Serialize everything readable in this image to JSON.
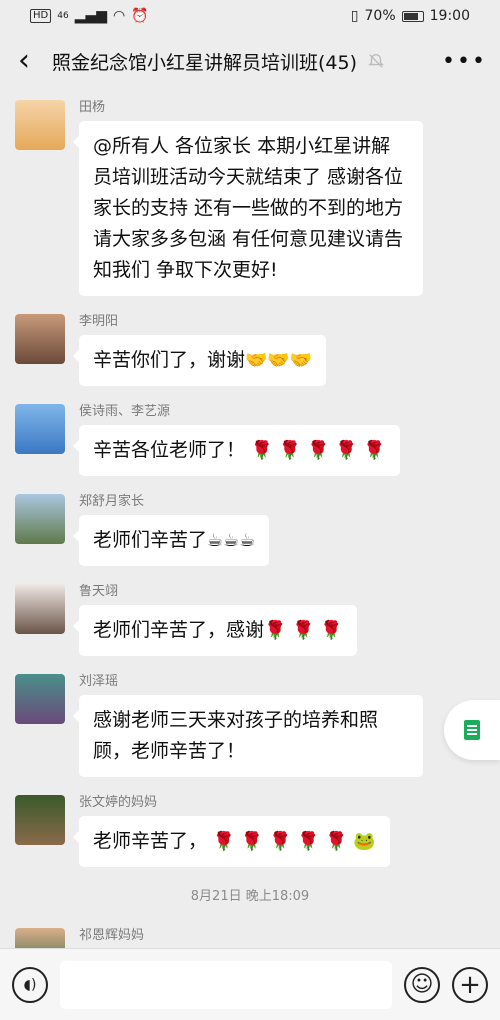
{
  "status_bar": {
    "hd": "HD",
    "signal": "46",
    "battery": "70%",
    "battery_level": 0.7,
    "time": "19:00"
  },
  "header": {
    "back_icon": "back-chevron-icon",
    "title": "照金纪念馆小红星讲解员培训班(45)",
    "mute_icon": "bell-muted-icon",
    "more_icon": "more-dots-icon"
  },
  "messages": [
    {
      "sender": "田杨",
      "text": "@所有人  各位家长 本期小红星讲解员培训班活动今天就结束了 感谢各位家长的支持 还有一些做的不到的地方请大家多多包涵 有任何意见建议请告知我们 争取下次更好!",
      "emoji": ""
    },
    {
      "sender": "李明阳",
      "text": "辛苦你们了，谢谢",
      "emoji": "🤝🤝🤝"
    },
    {
      "sender": "侯诗雨、李艺源",
      "text": "辛苦各位老师了！",
      "emoji": " 🌹 🌹 🌹 🌹 🌹"
    },
    {
      "sender": "郑舒月家长",
      "text": "老师们辛苦了",
      "emoji": "☕☕☕"
    },
    {
      "sender": "鲁天翊",
      "text": "老师们辛苦了，感谢",
      "emoji": "🌹 🌹 🌹"
    },
    {
      "sender": "刘泽瑶",
      "text": "感谢老师三天来对孩子的培养和照顾，老师辛苦了！",
      "emoji": ""
    },
    {
      "sender": "张文婷的妈妈",
      "text": "老师辛苦了，",
      "emoji": " 🌹 🌹 🌹 🌹 🌹 🐸"
    }
  ],
  "time_separator": "8月21日 晚上18:09",
  "last_sender": "祁恩辉妈妈",
  "input_bar": {
    "voice_icon": "voice-icon",
    "placeholder": "",
    "emoji_icon": "smiley-icon",
    "plus_icon": "plus-icon"
  },
  "side_float_icon": "document-icon",
  "colors": {
    "background": "#ededed",
    "bubble": "#ffffff",
    "accent": "#1aad5a"
  }
}
